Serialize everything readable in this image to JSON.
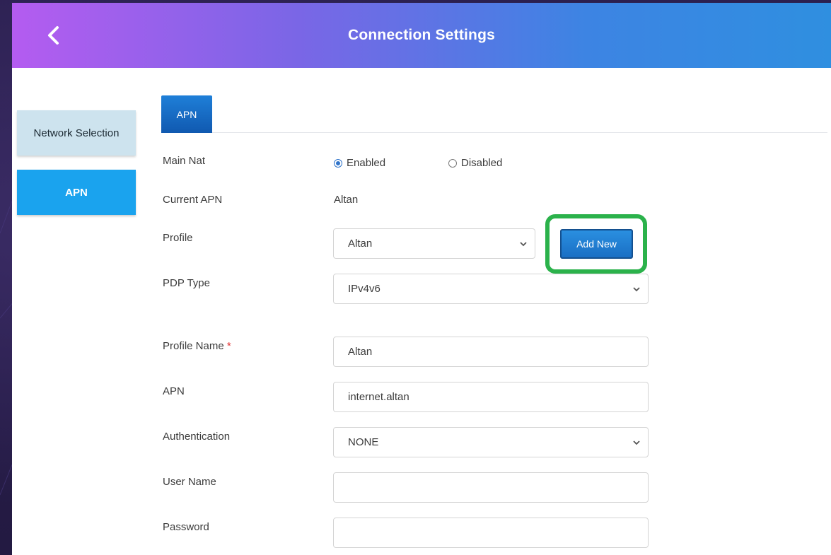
{
  "header": {
    "title": "Connection Settings",
    "back_icon": "chevron-left-icon"
  },
  "sidebar": {
    "items": [
      {
        "label": "Network Selection",
        "active": false
      },
      {
        "label": "APN",
        "active": true
      }
    ]
  },
  "tabs": [
    {
      "label": "APN",
      "active": true
    }
  ],
  "form": {
    "main_nat": {
      "label": "Main Nat",
      "options": [
        {
          "label": "Enabled",
          "selected": true
        },
        {
          "label": "Disabled",
          "selected": false
        }
      ]
    },
    "current_apn": {
      "label": "Current APN",
      "value": "Altan"
    },
    "profile": {
      "label": "Profile",
      "value": "Altan",
      "add_new_label": "Add New"
    },
    "pdp_type": {
      "label": "PDP Type",
      "value": "IPv4v6"
    },
    "profile_name": {
      "label": "Profile Name",
      "required_mark": "*",
      "value": "Altan"
    },
    "apn": {
      "label": "APN",
      "value": "internet.altan"
    },
    "authentication": {
      "label": "Authentication",
      "value": "NONE"
    },
    "user_name": {
      "label": "User Name",
      "value": ""
    },
    "password": {
      "label": "Password",
      "value": ""
    }
  },
  "colors": {
    "accent": "#1aa3ee",
    "highlight": "#2bb24b",
    "button": "#1a6fc4"
  }
}
